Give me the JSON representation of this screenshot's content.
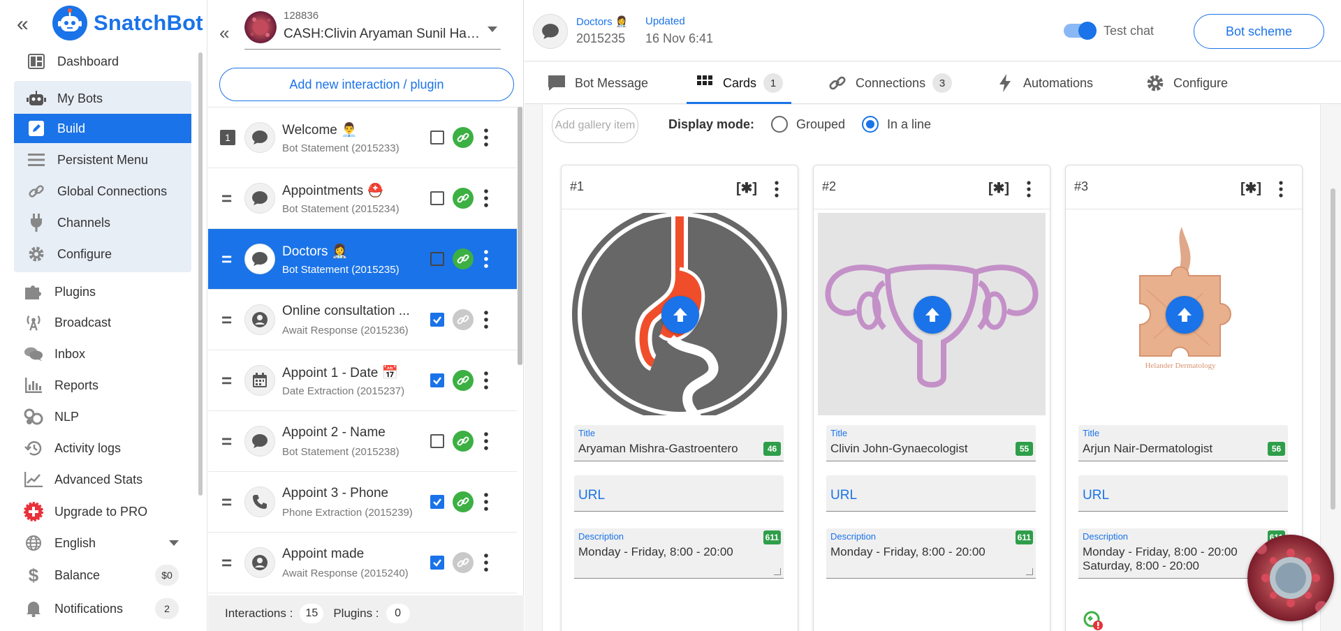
{
  "brand": {
    "name": "SnatchBot",
    "color": "#1a73e8"
  },
  "nav": {
    "items": [
      {
        "label": "Dashboard",
        "icon": "dashboard-icon"
      },
      {
        "label": "My Bots",
        "icon": "robot-icon"
      },
      {
        "label": "Build",
        "icon": "edit-icon",
        "active": true
      },
      {
        "label": "Persistent Menu",
        "icon": "menu-icon"
      },
      {
        "label": "Global Connections",
        "icon": "link-icon"
      },
      {
        "label": "Channels",
        "icon": "plug-icon"
      },
      {
        "label": "Configure",
        "icon": "gear-icon"
      },
      {
        "label": "Plugins",
        "icon": "puzzle-icon"
      },
      {
        "label": "Broadcast",
        "icon": "broadcast-icon"
      },
      {
        "label": "Inbox",
        "icon": "chat-icon"
      },
      {
        "label": "Reports",
        "icon": "bar-chart-icon"
      },
      {
        "label": "NLP",
        "icon": "nlp-icon"
      },
      {
        "label": "Activity logs",
        "icon": "history-icon"
      },
      {
        "label": "Advanced Stats",
        "icon": "line-chart-icon"
      },
      {
        "label": "Upgrade to PRO",
        "icon": "plus-badge-icon"
      },
      {
        "label": "English",
        "icon": "globe-icon"
      },
      {
        "label": "Balance",
        "icon": "dollar-icon",
        "pill": "$0"
      },
      {
        "label": "Notifications",
        "icon": "bell-icon",
        "pill": "2"
      }
    ]
  },
  "bot": {
    "id": "128836",
    "name": "CASH:Clivin Aryaman Sunil Harsha"
  },
  "middle": {
    "add_button": "Add new interaction / plugin",
    "rows": [
      {
        "marker": "1",
        "title": "Welcome 👨‍💼",
        "subtitle": "Bot Statement (2015233)",
        "checked": false,
        "linked": true
      },
      {
        "marker": "=",
        "title": "Appointments ⛑️",
        "subtitle": "Bot Statement (2015234)",
        "checked": false,
        "linked": true
      },
      {
        "marker": "=",
        "title": "Doctors 👩‍⚕️",
        "subtitle": "Bot Statement (2015235)",
        "checked": false,
        "linked": true,
        "selected": true
      },
      {
        "marker": "=",
        "title": "Online consultation ...",
        "subtitle": "Await Response (2015236)",
        "checked": true,
        "linked": false
      },
      {
        "marker": "=",
        "title": "Appoint 1 - Date 📅",
        "subtitle": "Date Extraction (2015237)",
        "checked": true,
        "linked": true
      },
      {
        "marker": "=",
        "title": "Appoint 2 - Name",
        "subtitle": "Bot Statement (2015238)",
        "checked": false,
        "linked": true
      },
      {
        "marker": "=",
        "title": "Appoint 3 - Phone",
        "subtitle": "Phone Extraction (2015239)",
        "checked": true,
        "linked": true
      },
      {
        "marker": "=",
        "title": "Appoint made",
        "subtitle": "Await Response (2015240)",
        "checked": true,
        "linked": false
      }
    ],
    "footer": {
      "interactions_label": "Interactions :",
      "interactions": "15",
      "plugins_label": "Plugins :",
      "plugins": "0"
    }
  },
  "header": {
    "title": "Doctors 👩‍⚕️",
    "id": "2015235",
    "updated_label": "Updated",
    "updated_value": "16 Nov 6:41",
    "test_chat": "Test chat",
    "bot_scheme": "Bot scheme"
  },
  "tabs": [
    {
      "label": "Bot Message",
      "icon": "message-icon"
    },
    {
      "label": "Cards",
      "icon": "grid-icon",
      "badge": "1",
      "active": true
    },
    {
      "label": "Connections",
      "icon": "link-icon",
      "badge": "3"
    },
    {
      "label": "Automations",
      "icon": "bolt-icon"
    },
    {
      "label": "Configure",
      "icon": "gear-icon"
    }
  ],
  "gallery": {
    "add_item": "Add gallery item",
    "display_mode_label": "Display mode:",
    "modes": [
      "Grouped",
      "In a line"
    ],
    "selected_mode": "In a line",
    "cards": [
      {
        "number": "#1",
        "image": "stomach-icon",
        "title_label": "Title",
        "title": "Aryaman Mishra-Gastroentero",
        "title_count": "46",
        "url_label": "URL",
        "description_label": "Description",
        "description": "Monday - Friday, 8:00 - 20:00",
        "description_count": "611"
      },
      {
        "number": "#2",
        "image": "uterus-icon",
        "title_label": "Title",
        "title": "Clivin John-Gynaecologist",
        "title_count": "55",
        "url_label": "URL",
        "description_label": "Description",
        "description": "Monday - Friday, 8:00 - 20:00",
        "description_count": "611"
      },
      {
        "number": "#3",
        "image": "skin-puzzle-icon",
        "image_caption": "Helander Dermatology",
        "title_label": "Title",
        "title": "Arjun Nair-Dermatologist",
        "title_count": "56",
        "url_label": "URL",
        "description_label": "Description",
        "description": "Monday - Friday, 8:00 - 20:00\nSaturday, 8:00 - 20:00",
        "description_count": "611"
      }
    ]
  }
}
